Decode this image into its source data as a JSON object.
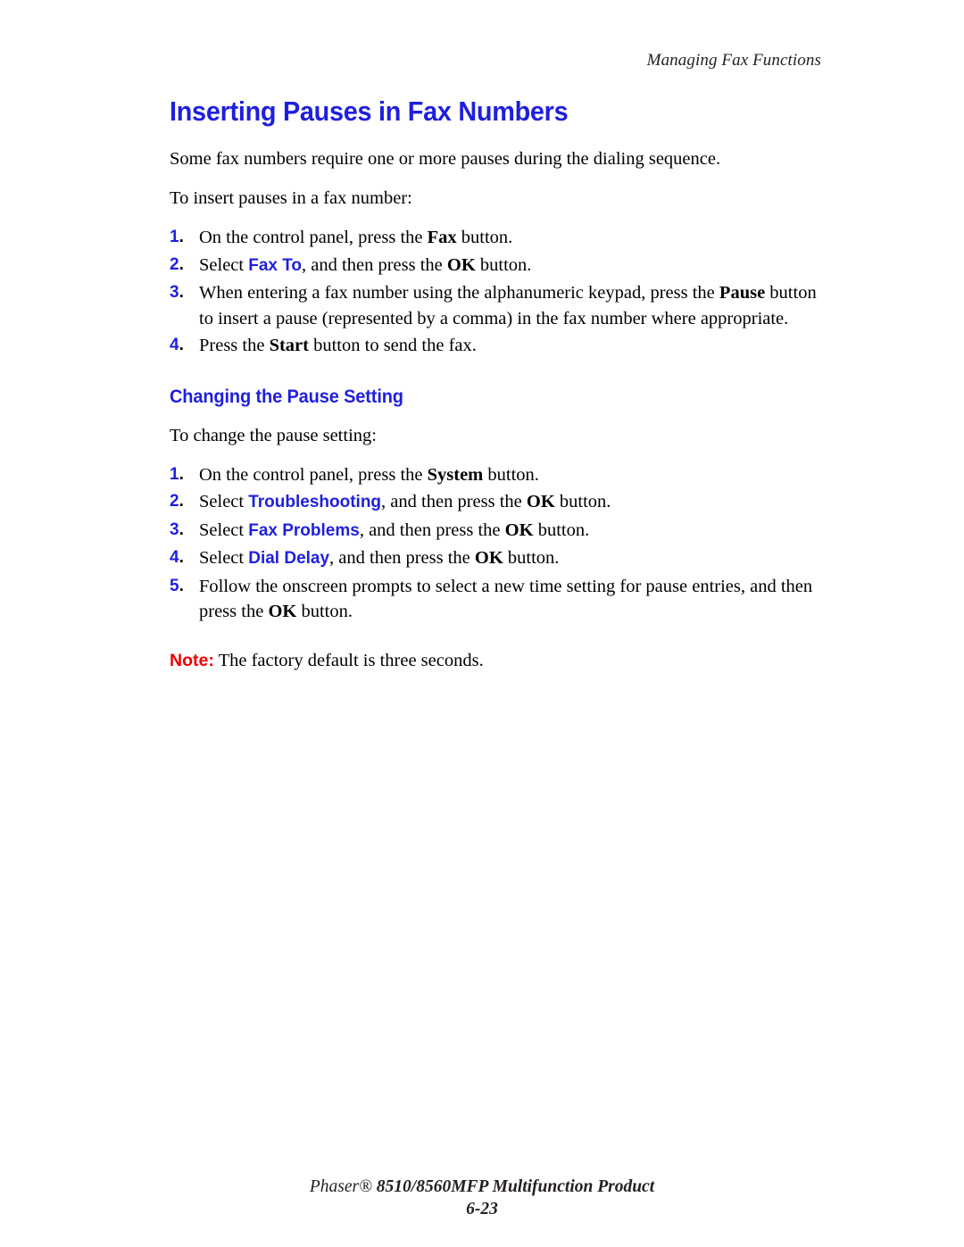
{
  "page": {
    "running_header": "Managing Fax Functions",
    "title": "Inserting Pauses in Fax Numbers",
    "intro_paragraph": "Some fax numbers require one or more pauses during the dialing sequence.",
    "lead_in": "To insert pauses in a fax number:"
  },
  "steps_insert": [
    {
      "number": "1.",
      "parts": [
        {
          "type": "text",
          "value": "On the control panel, press the "
        },
        {
          "type": "bold",
          "value": "Fax"
        },
        {
          "type": "text",
          "value": " button."
        }
      ]
    },
    {
      "number": "2.",
      "parts": [
        {
          "type": "text",
          "value": "Select "
        },
        {
          "type": "menu",
          "value": "Fax To"
        },
        {
          "type": "text",
          "value": ", and then press the "
        },
        {
          "type": "bold",
          "value": "OK"
        },
        {
          "type": "text",
          "value": " button."
        }
      ]
    },
    {
      "number": "3.",
      "parts": [
        {
          "type": "text",
          "value": "When entering a fax number using the alphanumeric keypad, press the "
        },
        {
          "type": "bold",
          "value": "Pause"
        },
        {
          "type": "text",
          "value": " button to insert a pause (represented by a comma) in the fax number where appropriate."
        }
      ]
    },
    {
      "number": "4.",
      "parts": [
        {
          "type": "text",
          "value": "Press the "
        },
        {
          "type": "bold",
          "value": "Start"
        },
        {
          "type": "text",
          "value": " button to send the fax."
        }
      ]
    }
  ],
  "section": {
    "subtitle": "Changing the Pause Setting",
    "lead_in": "To change the pause setting:"
  },
  "steps_change": [
    {
      "number": "1.",
      "parts": [
        {
          "type": "text",
          "value": "On the control panel, press the "
        },
        {
          "type": "bold",
          "value": "System"
        },
        {
          "type": "text",
          "value": " button."
        }
      ]
    },
    {
      "number": "2.",
      "parts": [
        {
          "type": "text",
          "value": "Select "
        },
        {
          "type": "menu",
          "value": "Troubleshooting"
        },
        {
          "type": "text",
          "value": ", and then press the "
        },
        {
          "type": "bold",
          "value": "OK"
        },
        {
          "type": "text",
          "value": " button."
        }
      ]
    },
    {
      "number": "3.",
      "parts": [
        {
          "type": "text",
          "value": "Select "
        },
        {
          "type": "menu",
          "value": "Fax Problems"
        },
        {
          "type": "text",
          "value": ", and then press the "
        },
        {
          "type": "bold",
          "value": "OK"
        },
        {
          "type": "text",
          "value": " button."
        }
      ]
    },
    {
      "number": "4.",
      "parts": [
        {
          "type": "text",
          "value": "Select "
        },
        {
          "type": "menu",
          "value": "Dial Delay"
        },
        {
          "type": "text",
          "value": ", and then press the "
        },
        {
          "type": "bold",
          "value": "OK"
        },
        {
          "type": "text",
          "value": " button."
        }
      ]
    },
    {
      "number": "5.",
      "parts": [
        {
          "type": "text",
          "value": "Follow the onscreen prompts to select a new time setting for pause entries, and then press the "
        },
        {
          "type": "bold",
          "value": "OK"
        },
        {
          "type": "text",
          "value": " button."
        }
      ]
    }
  ],
  "note": {
    "label": "Note:",
    "text": " The factory default is three seconds."
  },
  "footer": {
    "brand": "Phaser® ",
    "product": "8510/8560MFP Multifunction Product",
    "page_number": "6-23"
  },
  "colors": {
    "heading_blue": "#1f1fdd",
    "note_red": "#ee0000",
    "body_black": "#000000"
  }
}
